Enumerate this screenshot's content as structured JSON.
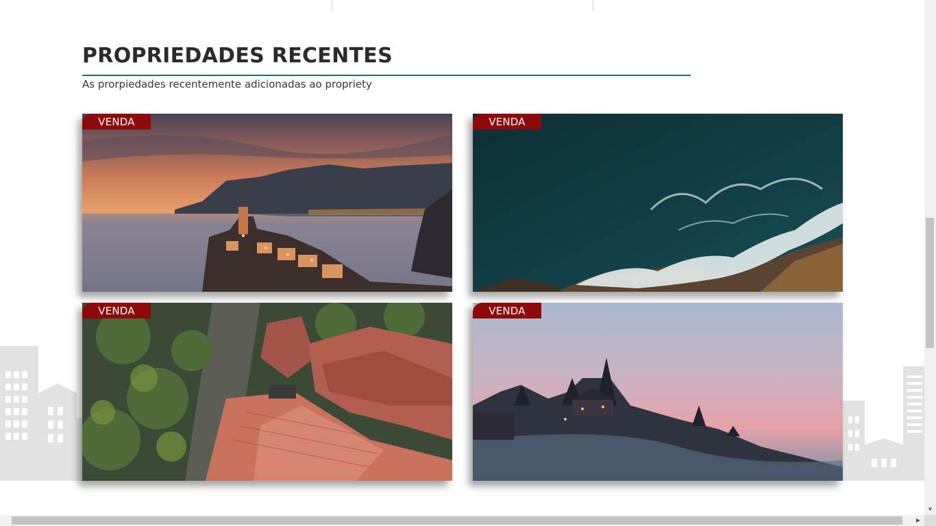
{
  "section": {
    "title": "PROPRIEDADES RECENTES",
    "subtitle": "As prorpiedades recentemente adicionadas ao propriety",
    "accent_color": "#1c6f73"
  },
  "properties": [
    {
      "badge": "VENDA",
      "image": "coastal-village-sunset"
    },
    {
      "badge": "VENDA",
      "image": "aerial-ocean-waves"
    },
    {
      "badge": "VENDA",
      "image": "aerial-red-roofs-palms"
    },
    {
      "badge": "VENDA",
      "image": "foggy-hillside-house-dusk"
    }
  ],
  "badge_color": "#8e0a0a"
}
